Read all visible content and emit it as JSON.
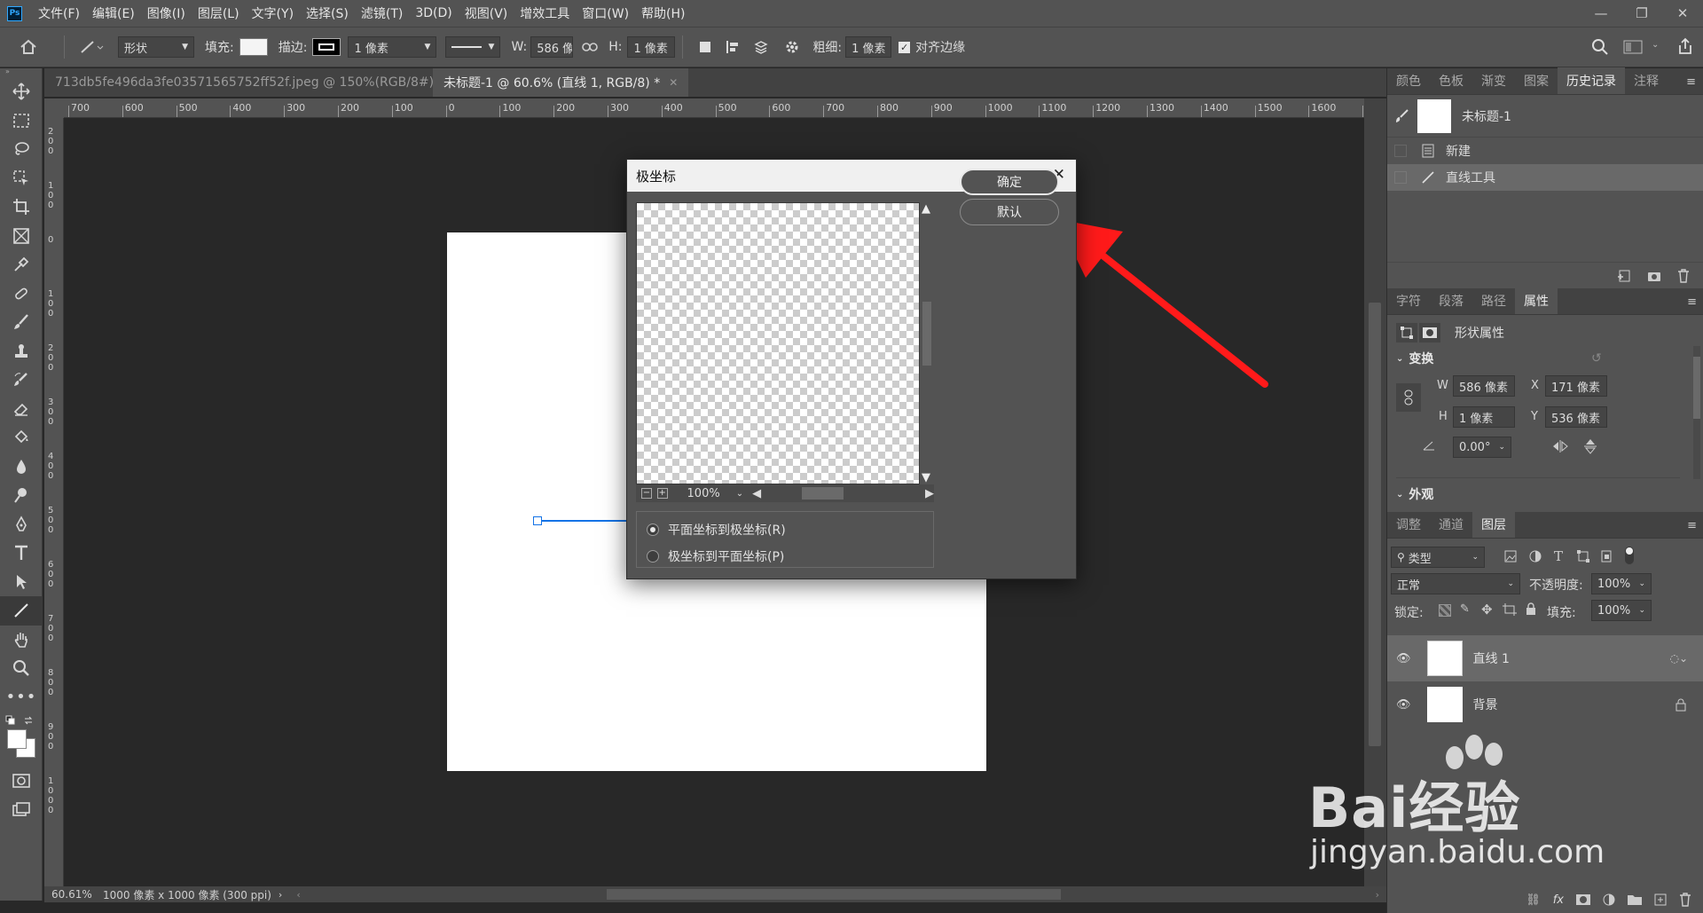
{
  "menubar": {
    "logo": "Ps",
    "items": [
      "文件(F)",
      "编辑(E)",
      "图像(I)",
      "图层(L)",
      "文字(Y)",
      "选择(S)",
      "滤镜(T)",
      "3D(D)",
      "视图(V)",
      "增效工具",
      "窗口(W)",
      "帮助(H)"
    ]
  },
  "options": {
    "mode": "形状",
    "fill_label": "填充:",
    "stroke_label": "描边:",
    "stroke_width": "1 像素",
    "w_label": "W:",
    "w_value": "586 像素",
    "h_label": "H:",
    "h_value": "1 像素",
    "weight_label": "粗细:",
    "weight_value": "1 像素",
    "align_edges": "对齐边缘"
  },
  "tabs": [
    {
      "label": "713db5fe496da3fe03571565752ff52f.jpeg @ 150%(RGB/8#)"
    },
    {
      "label": "未标题-1 @ 60.6% (直线 1, RGB/8) *"
    }
  ],
  "ruler": {
    "h_ticks": [
      "700",
      "600",
      "500",
      "400",
      "300",
      "200",
      "100",
      "0",
      "100",
      "200",
      "300",
      "400",
      "500",
      "600",
      "700",
      "800",
      "900",
      "1000",
      "1100",
      "1200",
      "1300",
      "1400",
      "1500",
      "1600",
      "1"
    ],
    "v_ticks": [
      "2 0 0",
      "1 0 0",
      "0",
      "1 0 0",
      "2 0 0",
      "3 0 0",
      "4 0 0",
      "5 0 0",
      "6 0 0",
      "7 0 0",
      "8 0 0",
      "9 0 0",
      "1 0 0 0"
    ]
  },
  "status": {
    "zoom": "60.61%",
    "doc_info": "1000 像素 x 1000 像素 (300 ppi)"
  },
  "dialog": {
    "title": "极坐标",
    "ok": "确定",
    "default": "默认",
    "zoom": "100%",
    "option1": "平面坐标到极坐标(R)",
    "option2": "极坐标到平面坐标(P)",
    "selected_option": "option1"
  },
  "history_panel": {
    "tabs": [
      "颜色",
      "色板",
      "渐变",
      "图案",
      "历史记录",
      "注释"
    ],
    "snapshot": "未标题-1",
    "items": [
      "新建",
      "直线工具"
    ]
  },
  "properties_panel": {
    "tabs": [
      "字符",
      "段落",
      "路径",
      "属性"
    ],
    "heading": "形状属性",
    "transform": "变换",
    "w_label": "W",
    "w": "586 像素",
    "x_label": "X",
    "x": "171 像素",
    "h_label": "H",
    "h": "1 像素",
    "y_label": "Y",
    "y": "536 像素",
    "angle": "0.00°",
    "appearance": "外观"
  },
  "layers_panel": {
    "tabs": [
      "调整",
      "通道",
      "图层"
    ],
    "filter": "类型",
    "blend": "正常",
    "opacity_label": "不透明度:",
    "opacity": "100%",
    "lock_label": "锁定:",
    "fill_label": "填充:",
    "fill": "100%",
    "layers": [
      "直线 1",
      "背景"
    ]
  },
  "watermark": {
    "brand": "Bai经验",
    "url": "jingyan.baidu.com"
  },
  "colors": {
    "arrow": "#ff1a1a",
    "selection": "#1473e6"
  }
}
